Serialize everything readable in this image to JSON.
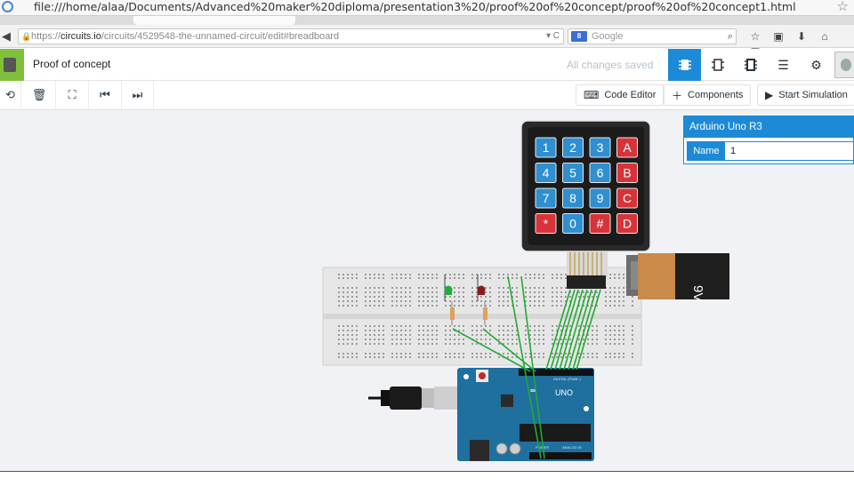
{
  "browser": {
    "file_url": "file:///home/alaa/Documents/Advanced%20maker%20diploma/presentation3%20/proof%20of%20concept/proof%20of%20concept1.html",
    "address_scheme": "https://",
    "address_host": "circuits.io",
    "address_path": "/circuits/4529548-the-unnamed-circuit/edit#breadboard",
    "search_placeholder": "Google",
    "search_engine_badge": "8",
    "icons": [
      "star-icon",
      "clipboard-icon",
      "download-icon",
      "home-icon",
      "menu-icon"
    ]
  },
  "app": {
    "project_title": "Proof of concept",
    "save_status": "All changes saved",
    "view_icons": [
      "breadboard-view-icon",
      "chip-view-icon",
      "pcb-view-icon",
      "list-view-icon",
      "settings-icon"
    ]
  },
  "toolbar": {
    "left_icons": [
      "rotate-icon",
      "trash-icon",
      "fit-icon",
      "step-back-icon",
      "step-forward-icon"
    ],
    "code_editor": "Code Editor",
    "components": "Components",
    "start_simulation": "Start Simulation"
  },
  "inspector": {
    "title": "Arduino Uno R3",
    "name_label": "Name",
    "name_value": "1"
  },
  "circuit": {
    "keypad_keys": [
      [
        "1",
        "2",
        "3",
        "A"
      ],
      [
        "4",
        "5",
        "6",
        "B"
      ],
      [
        "7",
        "8",
        "9",
        "C"
      ],
      [
        "*",
        "0",
        "#",
        "D"
      ]
    ],
    "battery_label": "9V",
    "board_labels": {
      "uno": "UNO",
      "digital": "DIGITAL (PWM~)",
      "analog": "ANALOG IN",
      "power": "POWER"
    },
    "colors": {
      "accent": "#1c8ad6",
      "key_blue": "#2f8fcf",
      "key_red": "#d7343a",
      "wire_green": "#22aa33",
      "arduino_blue": "#1f6f9f",
      "battery_orange": "#c98a4a"
    }
  }
}
